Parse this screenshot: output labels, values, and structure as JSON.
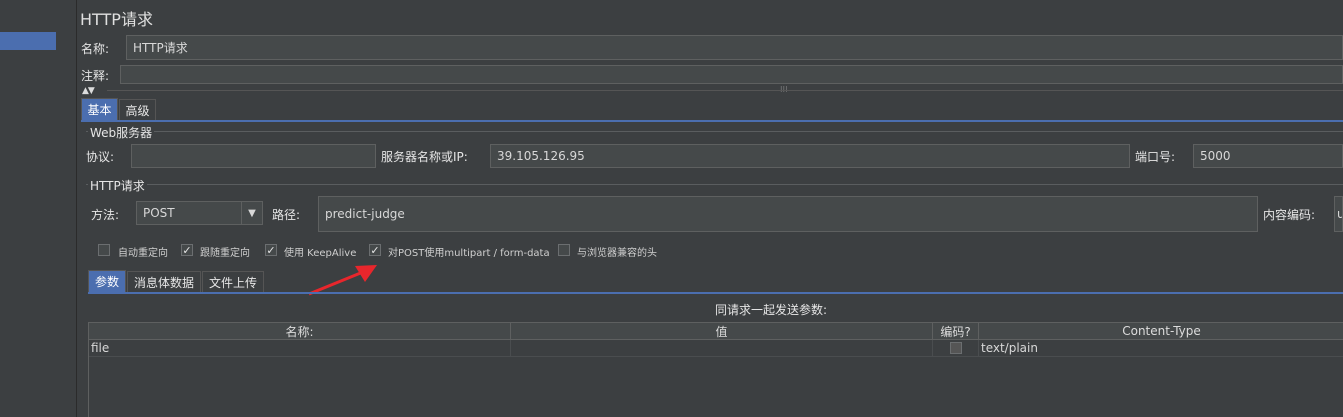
{
  "window": {
    "title": "HTTP请求"
  },
  "name_field": {
    "label": "名称:",
    "value": "HTTP请求"
  },
  "comment_field": {
    "label": "注释:",
    "value": ""
  },
  "tabs": [
    {
      "label": "基本"
    },
    {
      "label": "高级"
    }
  ],
  "web_server": {
    "group_title": "Web服务器",
    "protocol_label": "协议:",
    "protocol_value": "",
    "server_label": "服务器名称或IP:",
    "server_value": "39.105.126.95",
    "port_label": "端口号:",
    "port_value": "5000"
  },
  "http_request": {
    "group_title": "HTTP请求",
    "method_label": "方法:",
    "method_value": "POST",
    "path_label": "路径:",
    "path_value": "predict-judge",
    "encoding_label": "内容编码:",
    "encoding_value": "u"
  },
  "options": [
    {
      "label": "自动重定向",
      "checked": false
    },
    {
      "label": "跟随重定向",
      "checked": true
    },
    {
      "label": "使用 KeepAlive",
      "checked": true
    },
    {
      "label": "对POST使用multipart / form-data",
      "checked": true
    },
    {
      "label": "与浏览器兼容的头",
      "checked": false
    }
  ],
  "sub_tabs": [
    {
      "label": "参数"
    },
    {
      "label": "消息体数据"
    },
    {
      "label": "文件上传"
    }
  ],
  "params": {
    "caption": "同请求一起发送参数:",
    "columns": {
      "name": "名称:",
      "value": "值",
      "encode": "编码?",
      "content_type": "Content-Type"
    },
    "rows": [
      {
        "name": "file",
        "value": "",
        "encode": false,
        "content_type": "text/plain"
      }
    ]
  },
  "icons": {
    "collapse": "triangle-up-down-icon",
    "dropdown": "triangle-down-icon",
    "arrow": "red-arrow-annotation-icon"
  },
  "colors": {
    "selection": "#4b6eaf",
    "annotation_arrow": "#e8262c",
    "background": "#3c3f41"
  }
}
